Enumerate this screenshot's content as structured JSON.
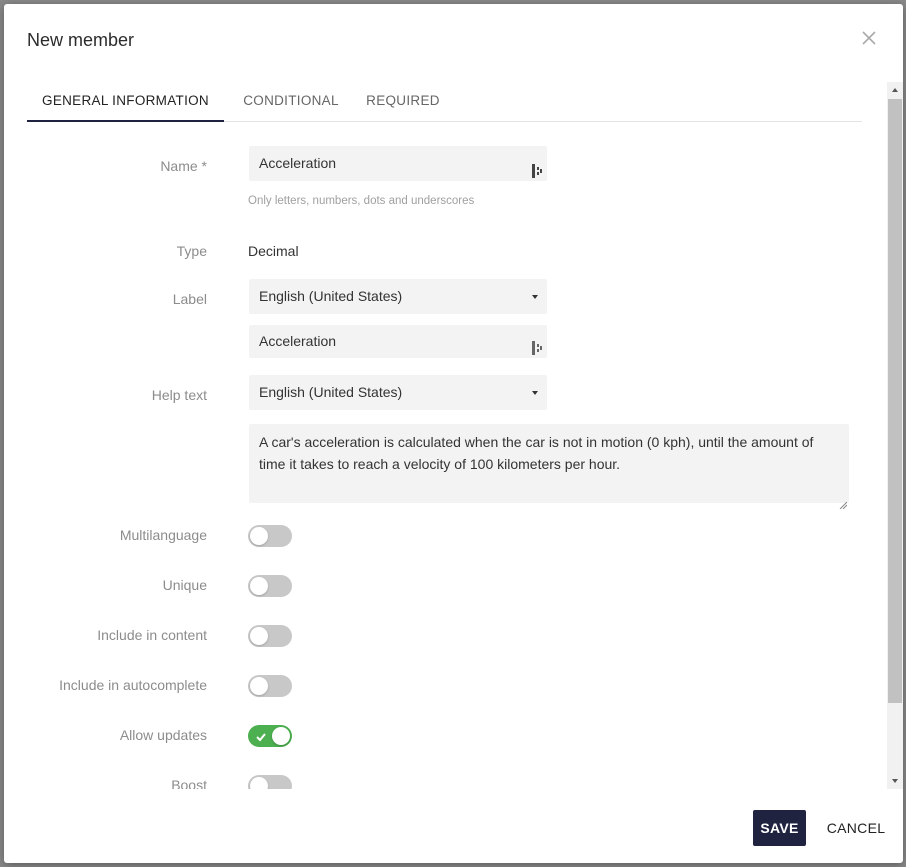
{
  "dialog": {
    "title": "New member"
  },
  "tabs": [
    {
      "label": "GENERAL INFORMATION",
      "active": true
    },
    {
      "label": "CONDITIONAL",
      "active": false
    },
    {
      "label": "REQUIRED",
      "active": false
    }
  ],
  "form": {
    "name": {
      "label": "Name *",
      "value": "Acceleration",
      "hint": "Only letters, numbers, dots and underscores"
    },
    "type": {
      "label": "Type",
      "value": "Decimal"
    },
    "label_field": {
      "label": "Label",
      "language": "English (United States)",
      "value": "Acceleration"
    },
    "help_text": {
      "label": "Help text",
      "language": "English (United States)",
      "value": "A car's acceleration is calculated when the car is not in motion (0 kph), until the amount of time it takes to reach a velocity of 100 kilometers per hour."
    },
    "toggles": [
      {
        "label": "Multilanguage",
        "on": false
      },
      {
        "label": "Unique",
        "on": false
      },
      {
        "label": "Include in content",
        "on": false
      },
      {
        "label": "Include in autocomplete",
        "on": false
      },
      {
        "label": "Allow updates",
        "on": true
      },
      {
        "label": "Boost",
        "on": false
      }
    ]
  },
  "footer": {
    "save_label": "SAVE",
    "cancel_label": "CANCEL"
  },
  "colors": {
    "primary": "#1f2340",
    "toggle_on": "#4caf50",
    "toggle_off": "#c8c8c8"
  }
}
